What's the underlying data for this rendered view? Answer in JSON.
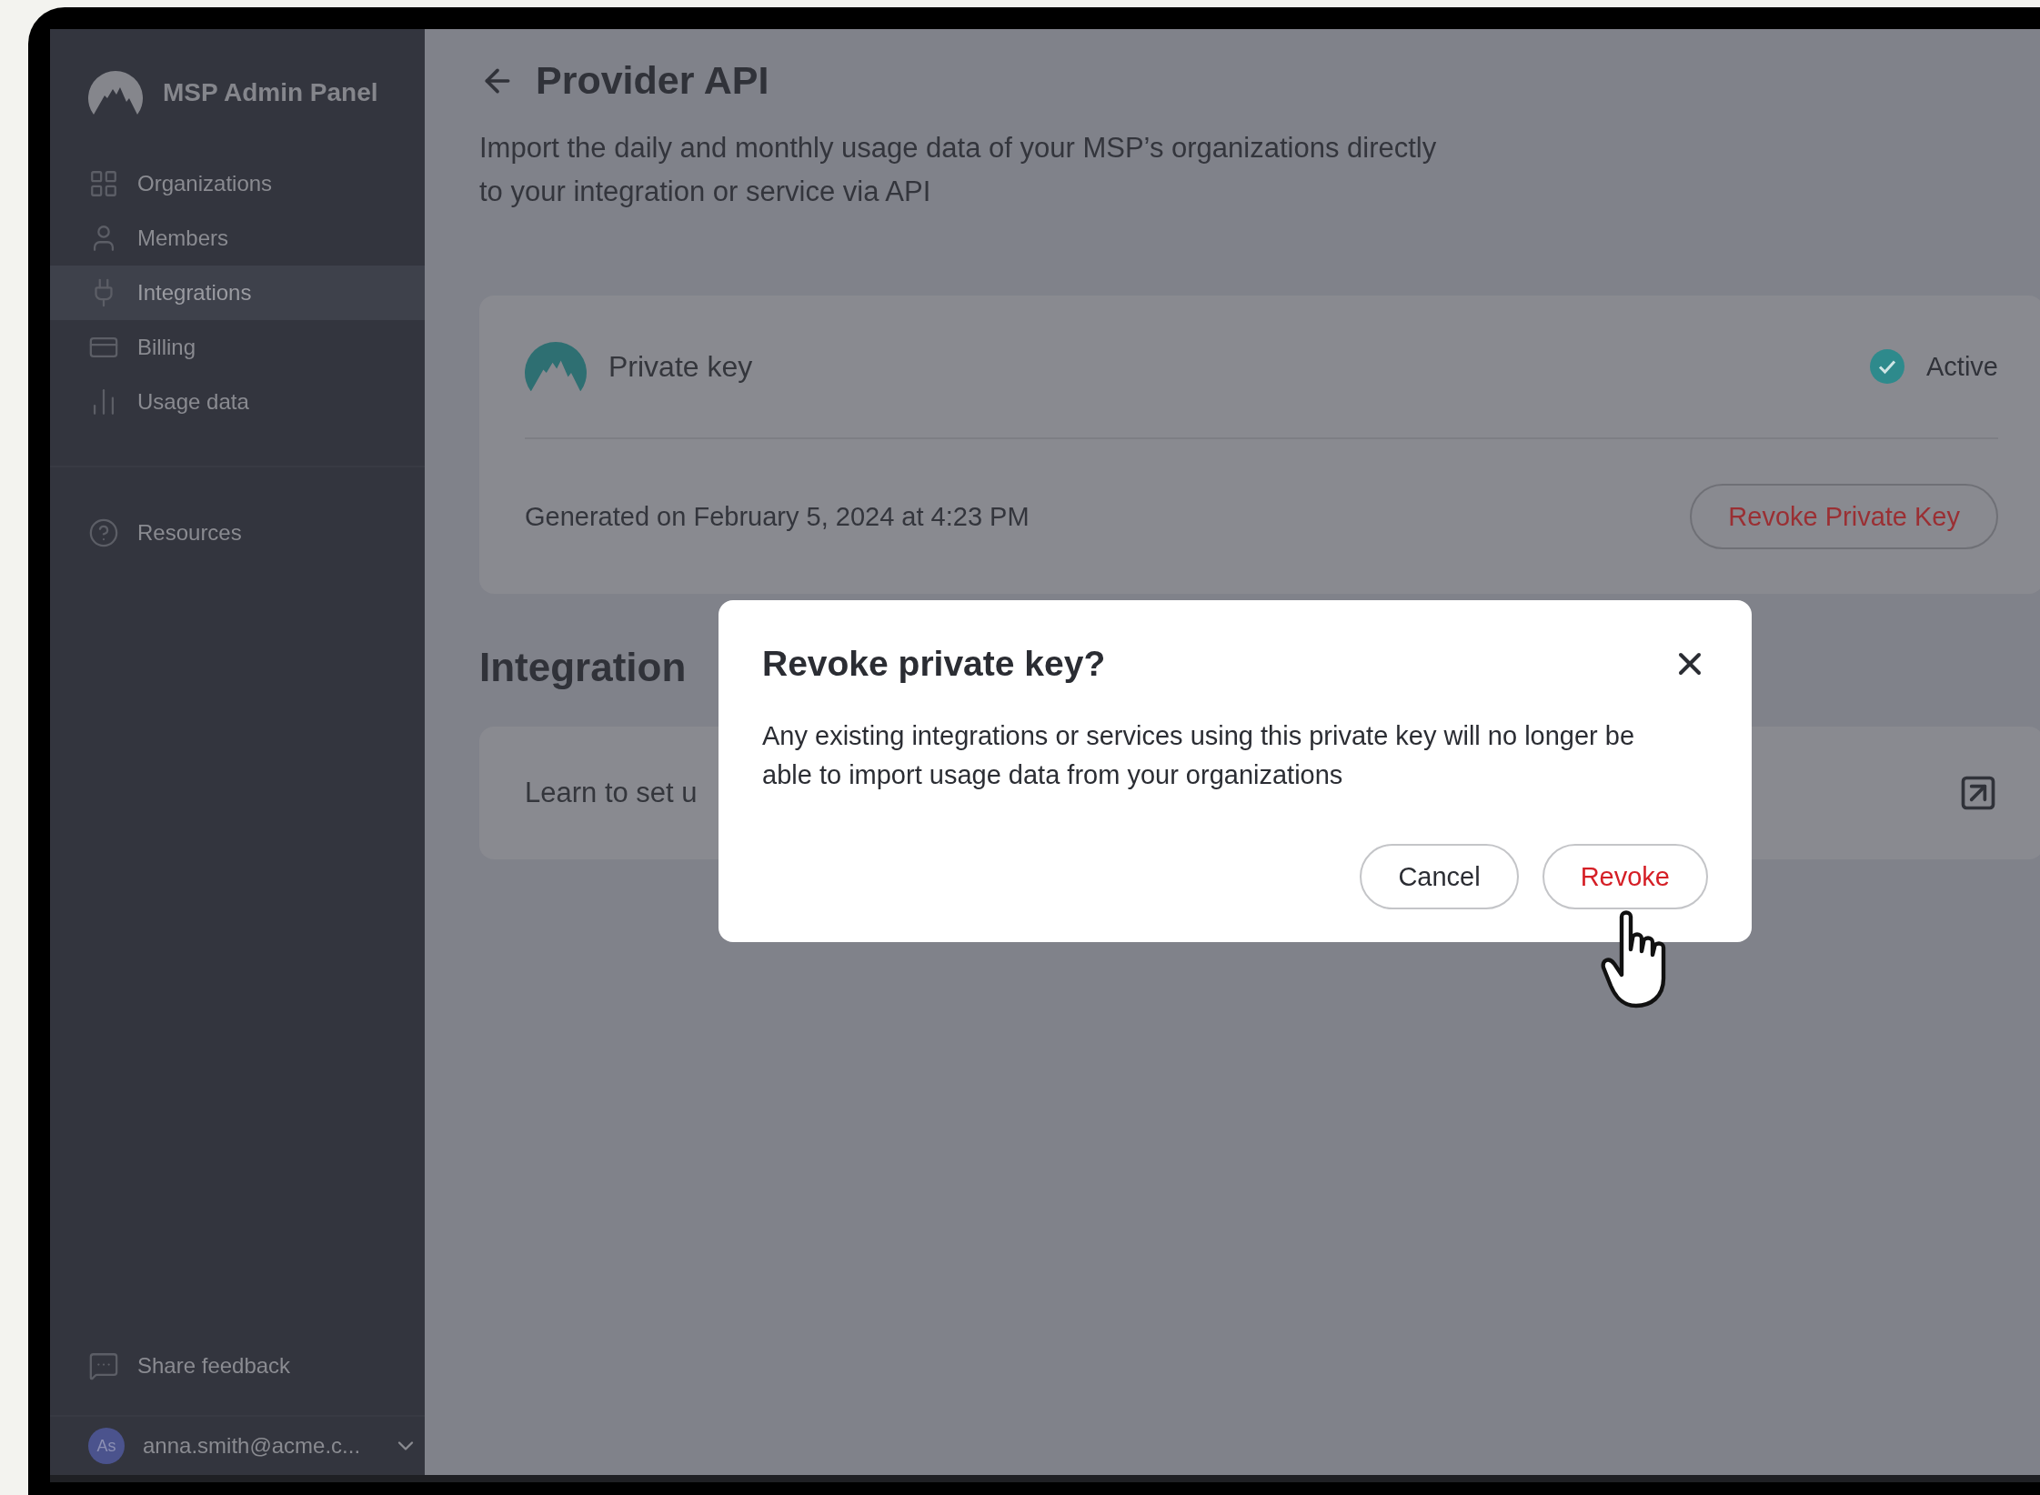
{
  "sidebar": {
    "brand": "MSP Admin Panel",
    "items": [
      {
        "label": "Organizations",
        "selected": false
      },
      {
        "label": "Members",
        "selected": false
      },
      {
        "label": "Integrations",
        "selected": true
      },
      {
        "label": "Billing",
        "selected": false
      },
      {
        "label": "Usage data",
        "selected": false
      }
    ],
    "secondary_items": [
      {
        "label": "Resources",
        "selected": false
      }
    ],
    "feedback": "Share feedback",
    "user": {
      "initials": "As",
      "email": "anna.smith@acme.c..."
    }
  },
  "page": {
    "title": "Provider API",
    "description": "Import the daily and monthly usage data of your MSP’s organizations directly to your integration or service via API",
    "key_card": {
      "title": "Private key",
      "status": "Active",
      "active": true,
      "generated": "Generated on February 5, 2024 at 4:23 PM",
      "revoke_button": "Revoke Private Key"
    },
    "guide_heading": "Integration",
    "guide_card": {
      "text": "Learn to set u"
    }
  },
  "modal": {
    "title": "Revoke private key?",
    "body": "Any existing integrations or services using this private key will no longer be able to import usage data from your organizations",
    "buttons": [
      {
        "label": "Cancel",
        "kind": "secondary"
      },
      {
        "label": "Revoke",
        "kind": "danger"
      }
    ]
  }
}
